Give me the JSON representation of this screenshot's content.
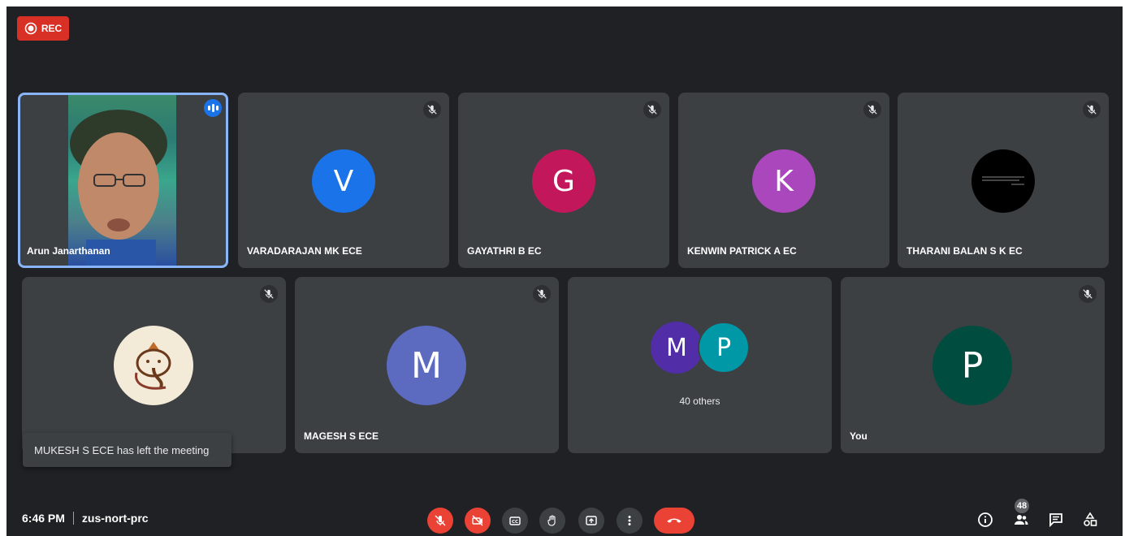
{
  "recording": {
    "label": "REC"
  },
  "tiles": [
    {
      "name": "Arun Janarthanan"
    },
    {
      "name": "VARADARAJAN MK ECE",
      "initial": "V",
      "color": "#1a73e8"
    },
    {
      "name": "GAYATHRI B EC",
      "initial": "G",
      "color": "#c2185b"
    },
    {
      "name": "KENWIN PATRICK A EC",
      "initial": "K",
      "color": "#ab47bc"
    },
    {
      "name": "THARANI BALAN S K EC"
    },
    {
      "name": ""
    },
    {
      "name": "MAGESH S ECE",
      "initial": "M",
      "color": "#5c6bc0"
    },
    {
      "others_label": "40 others",
      "initial_a": "M",
      "initial_b": "P",
      "color_a": "#512da8",
      "color_b": "#0097a7"
    },
    {
      "name": "You",
      "initial": "P",
      "color": "#004d40"
    }
  ],
  "notification": {
    "text": "MUKESH S ECE has left the meeting"
  },
  "footer": {
    "time": "6:46 PM",
    "meeting_code": "zus-nort-prc",
    "participants_count": "48"
  },
  "icons": {
    "mic": "mic-off-icon",
    "camera": "camera-off-icon",
    "captions": "captions-icon",
    "hand": "raise-hand-icon",
    "present": "present-icon",
    "more": "more-options-icon",
    "end": "end-call-icon",
    "info": "info-icon",
    "people": "people-icon",
    "chat": "chat-icon",
    "activities": "activities-icon"
  }
}
